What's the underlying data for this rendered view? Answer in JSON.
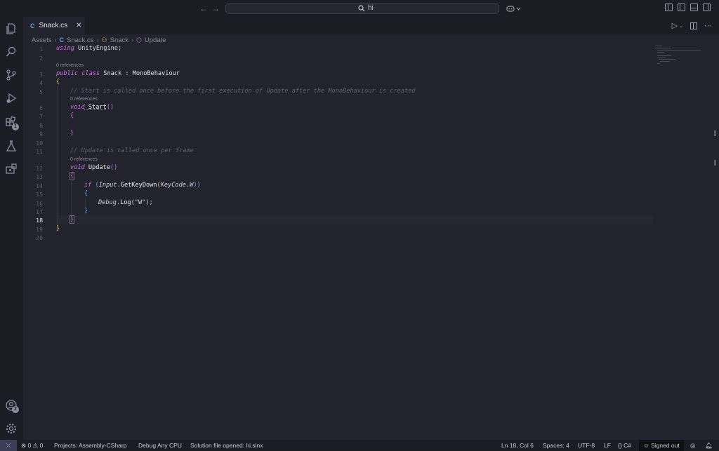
{
  "titlebar": {
    "search_text": "hi",
    "back_arrow": "←",
    "forward_arrow": "→"
  },
  "activity_bar": {
    "extensions_badge": "1",
    "accounts_badge": "2"
  },
  "tabs": [
    {
      "label": "Snack.cs",
      "icon": "csharp-file-icon",
      "close": "✕"
    }
  ],
  "breadcrumb": {
    "items": [
      "Assets",
      "Snack.cs",
      "Snack",
      "Update"
    ],
    "separator": "›"
  },
  "editor": {
    "line_numbers": [
      "1",
      "2",
      "3",
      "4",
      "5",
      "6",
      "7",
      "8",
      "9",
      "10",
      "11",
      "12",
      "13",
      "14",
      "15",
      "16",
      "17",
      "18",
      "19",
      "20"
    ],
    "active_line": "18",
    "codelens": "0 references",
    "code": {
      "l1_kw": "using",
      "l1_rest": " UnityEngine;",
      "l3_kw": "public class",
      "l3_name": " Snack ",
      "l3_colon": ": ",
      "l3_base": "MonoBehaviour",
      "l4": "{",
      "l5": "// Start is called once before the first execution of Update after the MonoBehaviour is created",
      "l6_kw": "void",
      "l6_name": " Start",
      "l6_paren": "()",
      "l7": "{",
      "l9": "}",
      "l11": "// Update is called once per frame",
      "l12_kw": "void",
      "l12_name": " Update",
      "l12_paren": "()",
      "l13": "{",
      "l14_if": "if",
      "l14_open": " (",
      "l14_input": "Input",
      "l14_dot": ".",
      "l14_method": "GetKeyDown",
      "l14_paren_open": "(",
      "l14_keycode": "KeyCode",
      "l14_dot2": ".",
      "l14_w": "W",
      "l14_close": "))",
      "l15": "{",
      "l16_debug": "Debug",
      "l16_dot": ".",
      "l16_log": "Log",
      "l16_args": "(\"W\");",
      "l17": "}",
      "l18": "}",
      "l19": "}"
    }
  },
  "statusbar": {
    "errors": "0",
    "warnings": "0",
    "project": "Projects: Assembly-CSharp",
    "debug": "Debug Any CPU",
    "solution": "Solution file opened: hi.slnx",
    "position": "Ln 18, Col 6",
    "spaces": "Spaces: 4",
    "encoding": "UTF-8",
    "eol": "LF",
    "language": "C#",
    "account": "Signed out"
  },
  "colors": {
    "background": "#22232d",
    "keyword": "#c678dd",
    "comment": "#5f6170",
    "bracket_gold": "#e5c07b",
    "bracket_blue": "#61afef"
  }
}
